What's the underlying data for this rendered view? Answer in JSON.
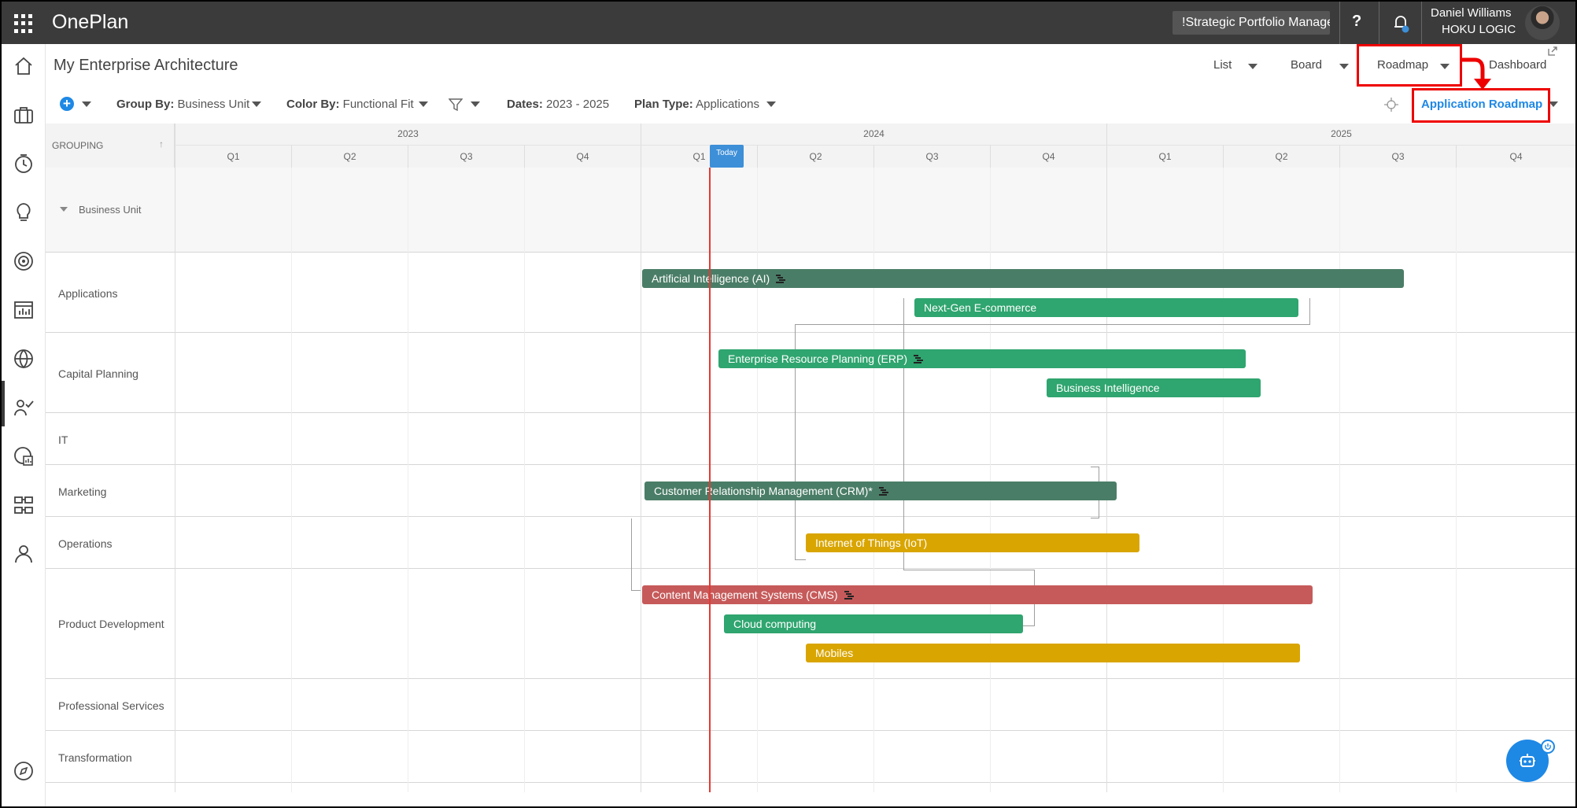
{
  "app": {
    "name": "OnePlan"
  },
  "topbar": {
    "portfolio": "!Strategic Portfolio Manager",
    "help": "?",
    "user_name": "Daniel Williams",
    "user_org": "HOKU LOGIC"
  },
  "page": {
    "title": "My Enterprise Architecture"
  },
  "views": [
    {
      "label": "List"
    },
    {
      "label": "Board"
    },
    {
      "label": "Roadmap"
    },
    {
      "label": "Dashboard"
    }
  ],
  "toolbar": {
    "group_by_label": "Group By:",
    "group_by_value": "Business Unit",
    "color_by_label": "Color By:",
    "color_by_value": "Functional Fit",
    "dates_label": "Dates:",
    "dates_value": "2023 - 2025",
    "plan_type_label": "Plan Type:",
    "plan_type_value": "Applications",
    "roadmap_selector": "Application Roadmap"
  },
  "gantt": {
    "grouping_header": "GROUPING",
    "years": [
      "2023",
      "2024",
      "2025"
    ],
    "quarters": [
      "Q1",
      "Q2",
      "Q3",
      "Q4",
      "Q1",
      "Q2",
      "Q3",
      "Q4",
      "Q1",
      "Q2",
      "Q3",
      "Q4"
    ],
    "today_label": "Today",
    "group_header_row": "Business Unit",
    "rows": [
      "Applications",
      "Capital Planning",
      "IT",
      "Marketing",
      "Operations",
      "Product Development",
      "Professional Services",
      "Transformation"
    ],
    "bars": [
      {
        "label": "Artificial Intelligence (AI)"
      },
      {
        "label": "Next-Gen E-commerce"
      },
      {
        "label": "Enterprise Resource Planning (ERP)"
      },
      {
        "label": "Business Intelligence"
      },
      {
        "label": "Customer Relationship Management (CRM)*"
      },
      {
        "label": "Internet of Things (IoT)"
      },
      {
        "label": "Content Management Systems (CMS)"
      },
      {
        "label": "Cloud computing"
      },
      {
        "label": "Mobiles"
      }
    ]
  },
  "colors": {
    "dark_green": "#4a7d67",
    "green": "#2fa56f",
    "yellow": "#d9a500",
    "red": "#c65a5a",
    "accent": "#1e88e5",
    "today": "#e53935"
  }
}
